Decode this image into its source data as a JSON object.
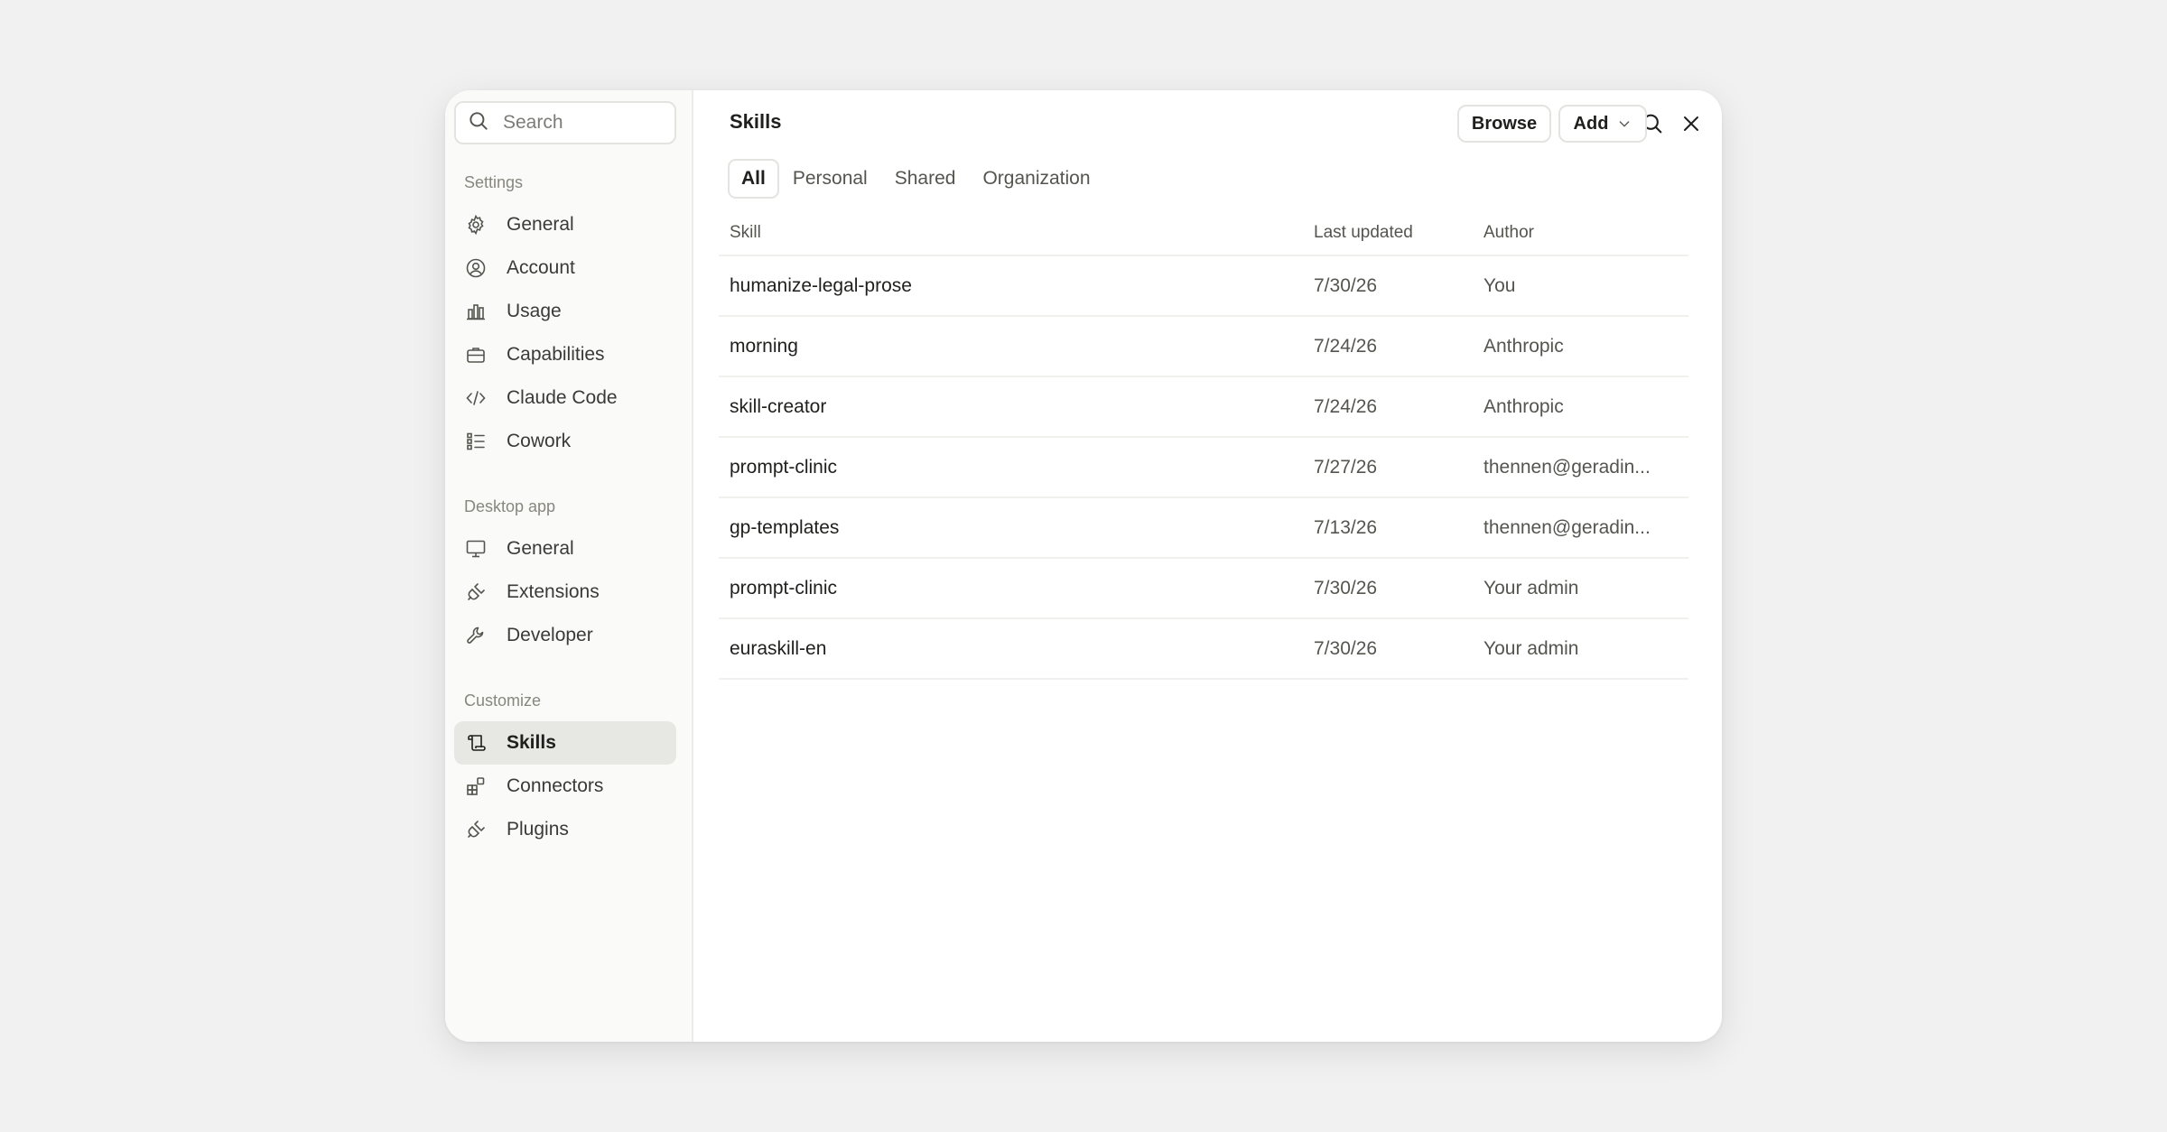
{
  "sidebar": {
    "search_placeholder": "Search",
    "sections": [
      {
        "label": "Settings",
        "items": [
          {
            "label": "General",
            "icon": "gear-icon"
          },
          {
            "label": "Account",
            "icon": "user-circle-icon"
          },
          {
            "label": "Usage",
            "icon": "bar-chart-icon"
          },
          {
            "label": "Capabilities",
            "icon": "briefcase-icon"
          },
          {
            "label": "Claude Code",
            "icon": "code-icon"
          },
          {
            "label": "Cowork",
            "icon": "checklist-icon"
          }
        ]
      },
      {
        "label": "Desktop app",
        "items": [
          {
            "label": "General",
            "icon": "monitor-icon"
          },
          {
            "label": "Extensions",
            "icon": "plug-icon"
          },
          {
            "label": "Developer",
            "icon": "wrench-icon"
          }
        ]
      },
      {
        "label": "Customize",
        "items": [
          {
            "label": "Skills",
            "icon": "scroll-icon",
            "active": true
          },
          {
            "label": "Connectors",
            "icon": "blocks-icon"
          },
          {
            "label": "Plugins",
            "icon": "plug-icon"
          }
        ]
      }
    ]
  },
  "main": {
    "title": "Skills",
    "browse_label": "Browse",
    "add_label": "Add",
    "tabs": [
      {
        "label": "All",
        "active": true
      },
      {
        "label": "Personal"
      },
      {
        "label": "Shared"
      },
      {
        "label": "Organization"
      }
    ],
    "table": {
      "headers": {
        "skill": "Skill",
        "updated": "Last updated",
        "author": "Author"
      },
      "rows": [
        {
          "skill": "humanize-legal-prose",
          "updated": "7/30/26",
          "author": "You"
        },
        {
          "skill": "morning",
          "updated": "7/24/26",
          "author": "Anthropic"
        },
        {
          "skill": "skill-creator",
          "updated": "7/24/26",
          "author": "Anthropic"
        },
        {
          "skill": "prompt-clinic",
          "updated": "7/27/26",
          "author": "thennen@geradin..."
        },
        {
          "skill": "gp-templates",
          "updated": "7/13/26",
          "author": "thennen@geradin..."
        },
        {
          "skill": "prompt-clinic",
          "updated": "7/30/26",
          "author": "Your admin"
        },
        {
          "skill": "euraskill-en",
          "updated": "7/30/26",
          "author": "Your admin"
        }
      ]
    }
  },
  "colors": {
    "background": "#f1f1f1",
    "window": "#ffffff",
    "sidebar": "#fafaf8",
    "active_item": "#e7e7e3",
    "text": "#1f1f1d",
    "muted": "#87877f"
  }
}
